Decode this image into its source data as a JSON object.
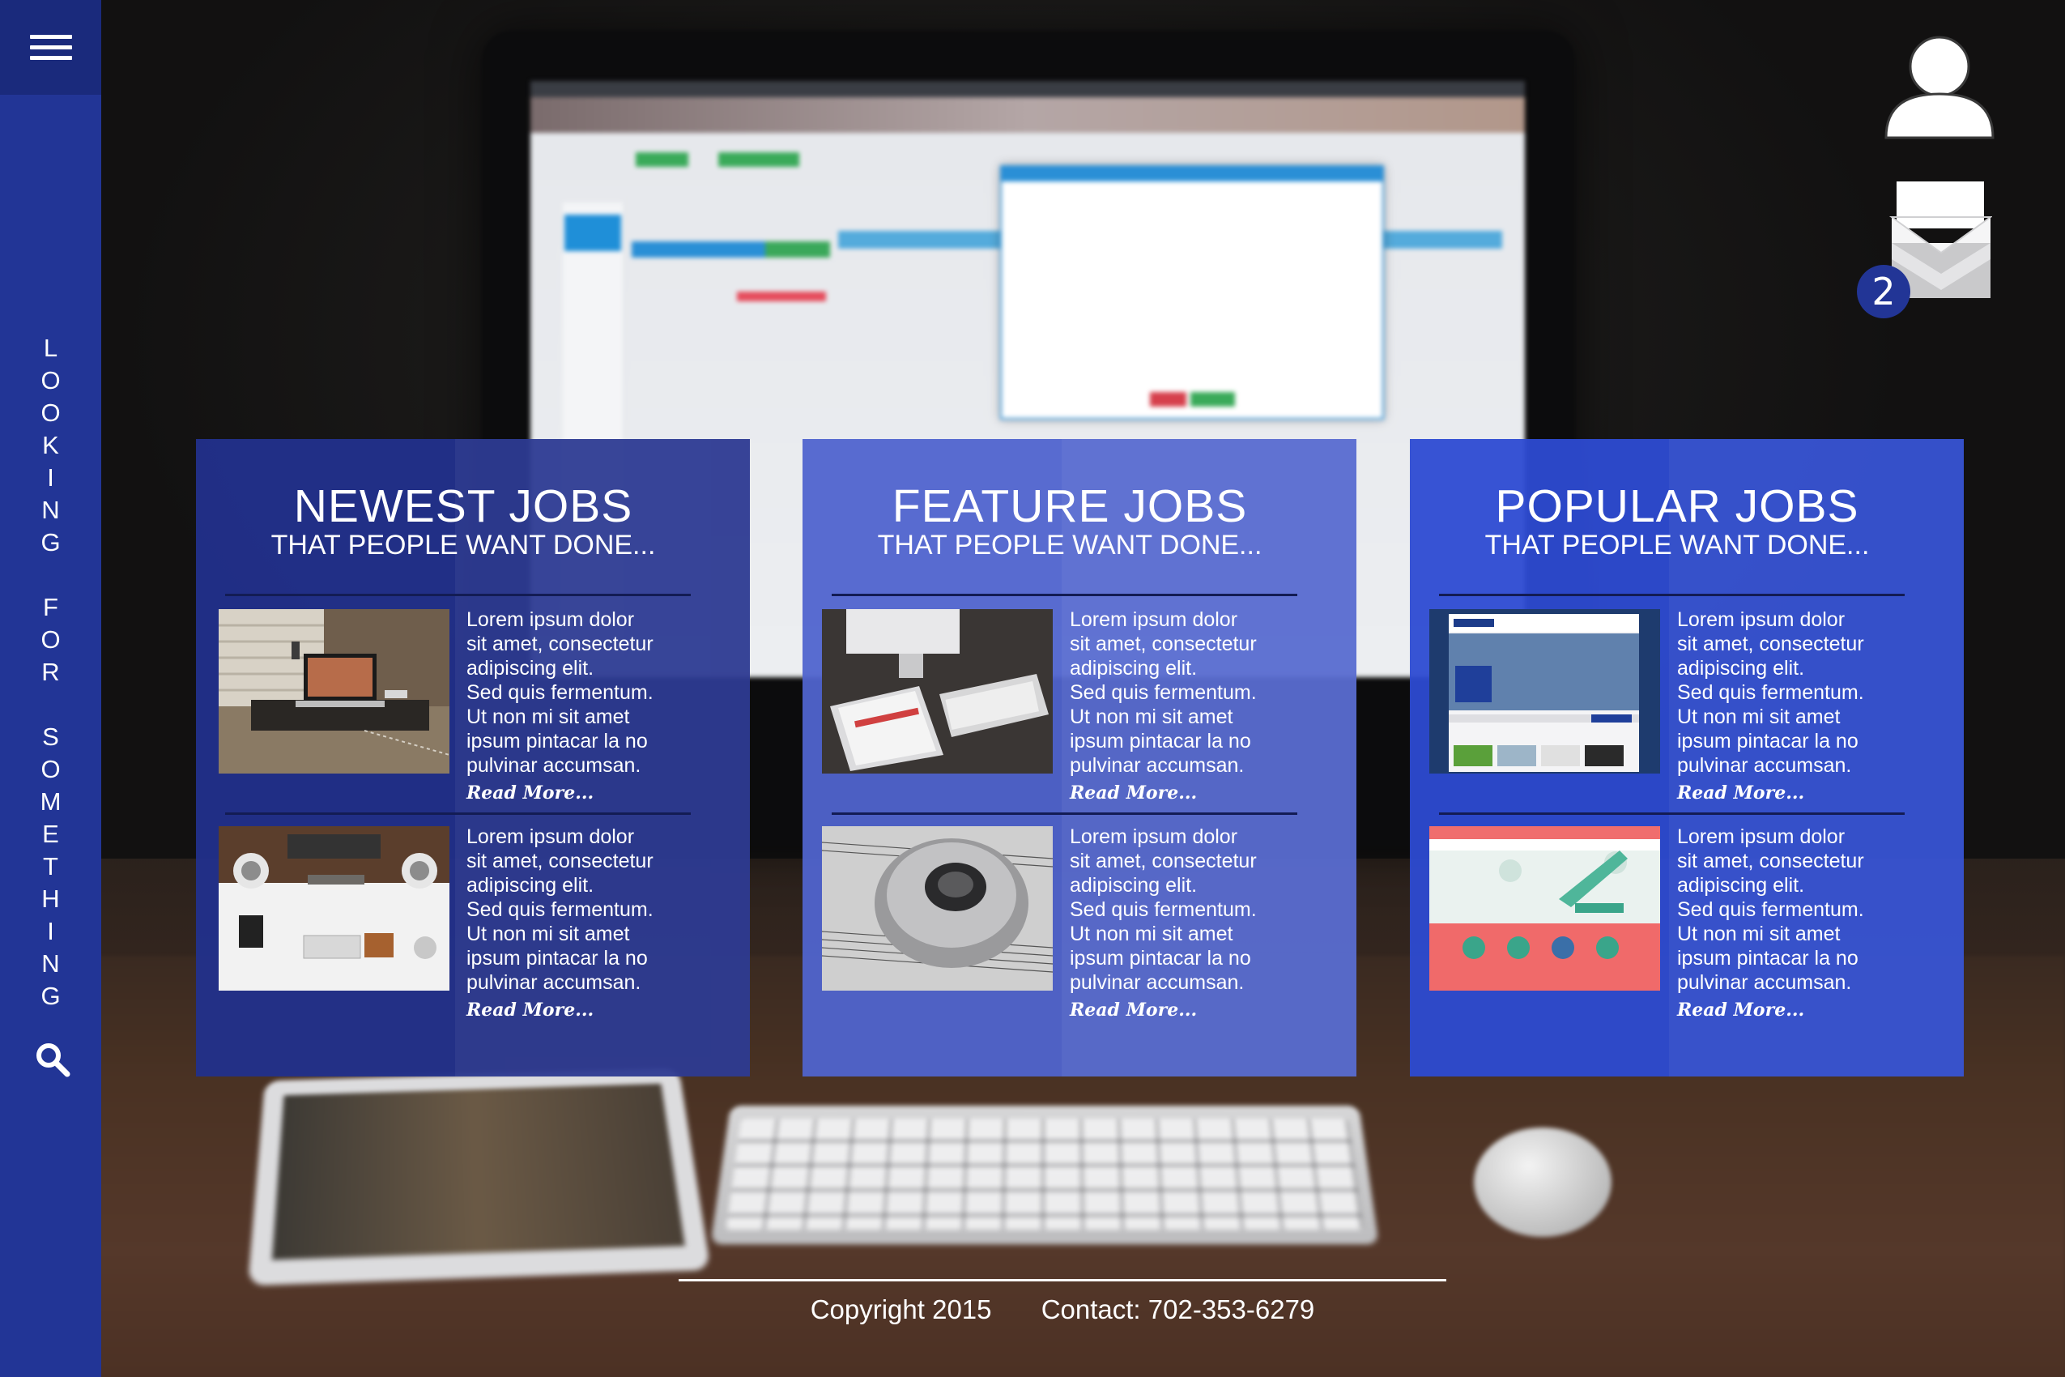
{
  "sidebar": {
    "menu_icon": "hamburger-menu-icon",
    "tagline_letters": [
      "L",
      "O",
      "O",
      "K",
      "I",
      "N",
      "G",
      " ",
      "F",
      "O",
      "R",
      " ",
      "S",
      "O",
      "M",
      "E",
      "T",
      "H",
      "I",
      "N",
      "G"
    ],
    "search_icon": "search-icon"
  },
  "header": {
    "user_icon": "user-icon",
    "message_icon": "envelope-icon",
    "message_count": "2"
  },
  "panels": [
    {
      "title": "NEWEST JOBS",
      "subtitle": "THAT PEOPLE WANT DONE...",
      "jobs": [
        {
          "thumb": "laptop-on-desk-photo",
          "desc": "Lorem ipsum dolor\nsit amet, consectetur\nadipiscing elit.\nSed quis fermentum.\nUt non mi sit amet\nipsum pintacar la no\npulvinar accumsan.",
          "more": "Read More..."
        },
        {
          "thumb": "workspace-topdown-photo",
          "desc": "Lorem ipsum dolor\nsit amet, consectetur\nadipiscing elit.\nSed quis fermentum.\nUt non mi sit amet\nipsum pintacar la no\npulvinar accumsan.",
          "more": "Read More..."
        }
      ]
    },
    {
      "title": "FEATURE JOBS",
      "subtitle": "THAT PEOPLE WANT DONE...",
      "jobs": [
        {
          "thumb": "tablet-keyboard-photo",
          "desc": "Lorem ipsum dolor\nsit amet, consectetur\nadipiscing elit.\nSed quis fermentum.\nUt non mi sit amet\nipsum pintacar la no\npulvinar accumsan.",
          "more": "Read More..."
        },
        {
          "thumb": "mouse-sheet-music-photo",
          "desc": "Lorem ipsum dolor\nsit amet, consectetur\nadipiscing elit.\nSed quis fermentum.\nUt non mi sit amet\nipsum pintacar la no\npulvinar accumsan.",
          "more": "Read More..."
        }
      ]
    },
    {
      "title": "POPULAR JOBS",
      "subtitle": "THAT PEOPLE WANT DONE...",
      "jobs": [
        {
          "thumb": "intersac-website-screenshot",
          "desc": "Lorem ipsum dolor\nsit amet, consectetur\nadipiscing elit.\nSed quis fermentum.\nUt non mi sit amet\nipsum pintacar la no\npulvinar accumsan.",
          "more": "Read More..."
        },
        {
          "thumb": "printing-website-screenshot",
          "desc": "Lorem ipsum dolor\nsit amet, consectetur\nadipiscing elit.\nSed quis fermentum.\nUt non mi sit amet\nipsum pintacar la no\npulvinar accumsan.",
          "more": "Read More..."
        }
      ]
    }
  ],
  "footer": {
    "copyright": "Copyright 2015",
    "contact": "Contact: 702-353-6279"
  },
  "colors": {
    "sidebar": "#223596",
    "menu_button": "#1a2a7c",
    "panel_newest": "#22308c",
    "panel_feature": "#5064cd",
    "panel_popular": "#2d4bd2"
  }
}
